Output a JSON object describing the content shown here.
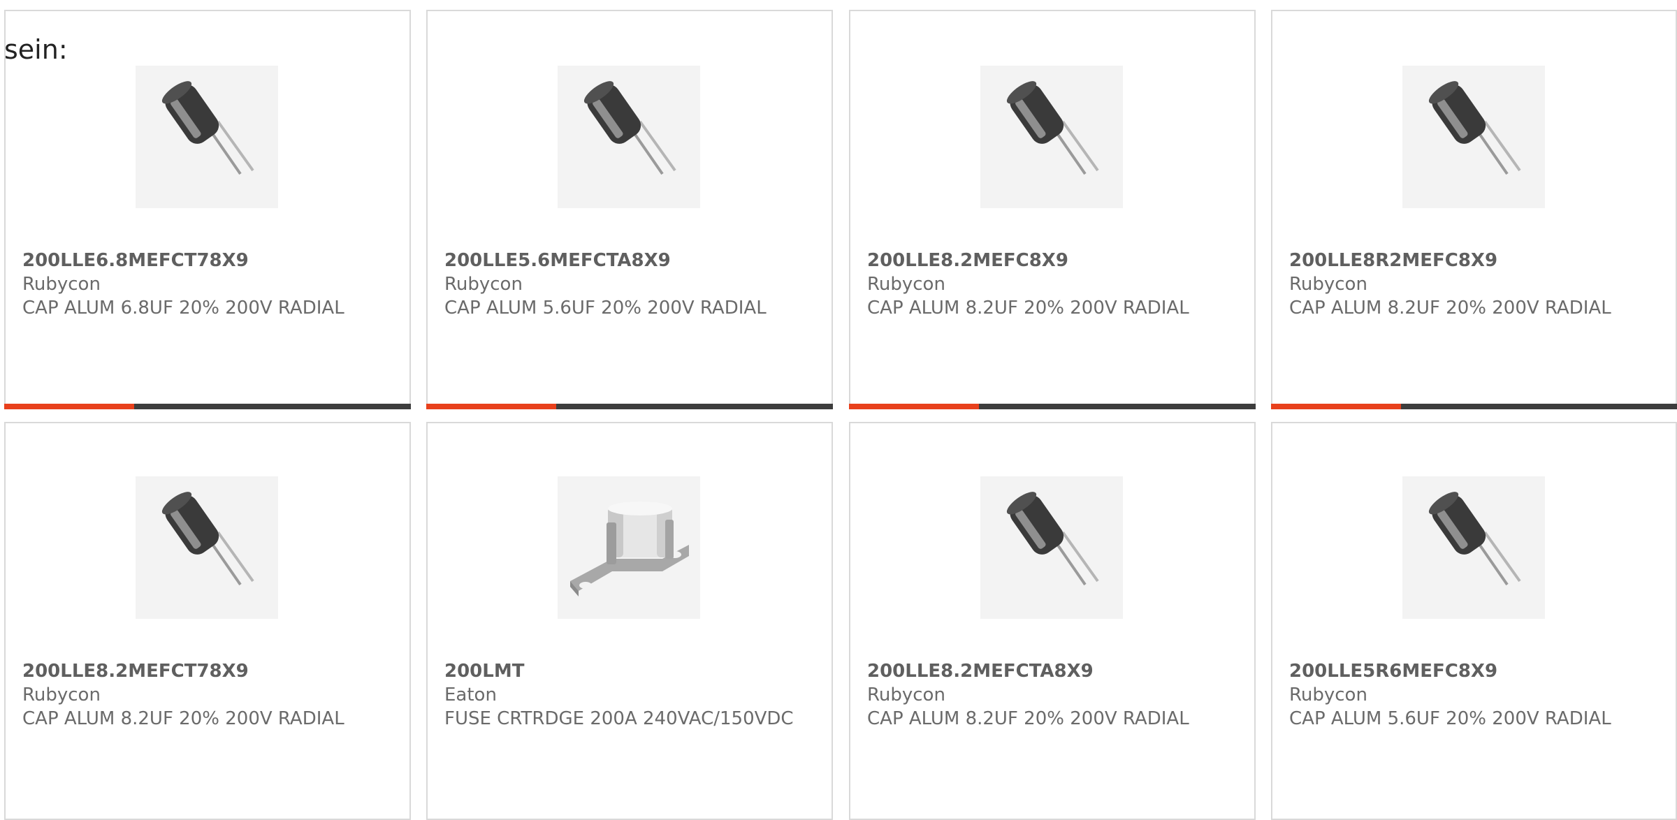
{
  "lead_text": "sein:",
  "colors": {
    "accent": "#e8401c",
    "bar_track": "#3d3d3d",
    "card_border": "#d9d9d9",
    "text": "#6a6a6a"
  },
  "cards": [
    {
      "part_number": "200LLE6.8MEFCT78X9",
      "manufacturer": "Rubycon",
      "description": "CAP ALUM 6.8UF 20% 200V RADIAL",
      "image_icon": "radial-capacitor-icon",
      "bar_fill_fraction": 0.32
    },
    {
      "part_number": "200LLE5.6MEFCTA8X9",
      "manufacturer": "Rubycon",
      "description": "CAP ALUM 5.6UF 20% 200V RADIAL",
      "image_icon": "radial-capacitor-icon",
      "bar_fill_fraction": 0.32
    },
    {
      "part_number": "200LLE8.2MEFC8X9",
      "manufacturer": "Rubycon",
      "description": "CAP ALUM 8.2UF 20% 200V RADIAL",
      "image_icon": "radial-capacitor-icon",
      "bar_fill_fraction": 0.32
    },
    {
      "part_number": "200LLE8R2MEFC8X9",
      "manufacturer": "Rubycon",
      "description": "CAP ALUM 8.2UF 20% 200V RADIAL",
      "image_icon": "radial-capacitor-icon",
      "bar_fill_fraction": 0.32
    },
    {
      "part_number": "200LLE8.2MEFCT78X9",
      "manufacturer": "Rubycon",
      "description": "CAP ALUM 8.2UF 20% 200V RADIAL",
      "image_icon": "radial-capacitor-icon"
    },
    {
      "part_number": "200LMT",
      "manufacturer": "Eaton",
      "description": "FUSE CRTRDGE 200A 240VAC/150VDC",
      "image_icon": "cartridge-fuse-icon"
    },
    {
      "part_number": "200LLE8.2MEFCTA8X9",
      "manufacturer": "Rubycon",
      "description": "CAP ALUM 8.2UF 20% 200V RADIAL",
      "image_icon": "radial-capacitor-icon"
    },
    {
      "part_number": "200LLE5R6MEFC8X9",
      "manufacturer": "Rubycon",
      "description": "CAP ALUM 5.6UF 20% 200V RADIAL",
      "image_icon": "radial-capacitor-icon"
    }
  ]
}
